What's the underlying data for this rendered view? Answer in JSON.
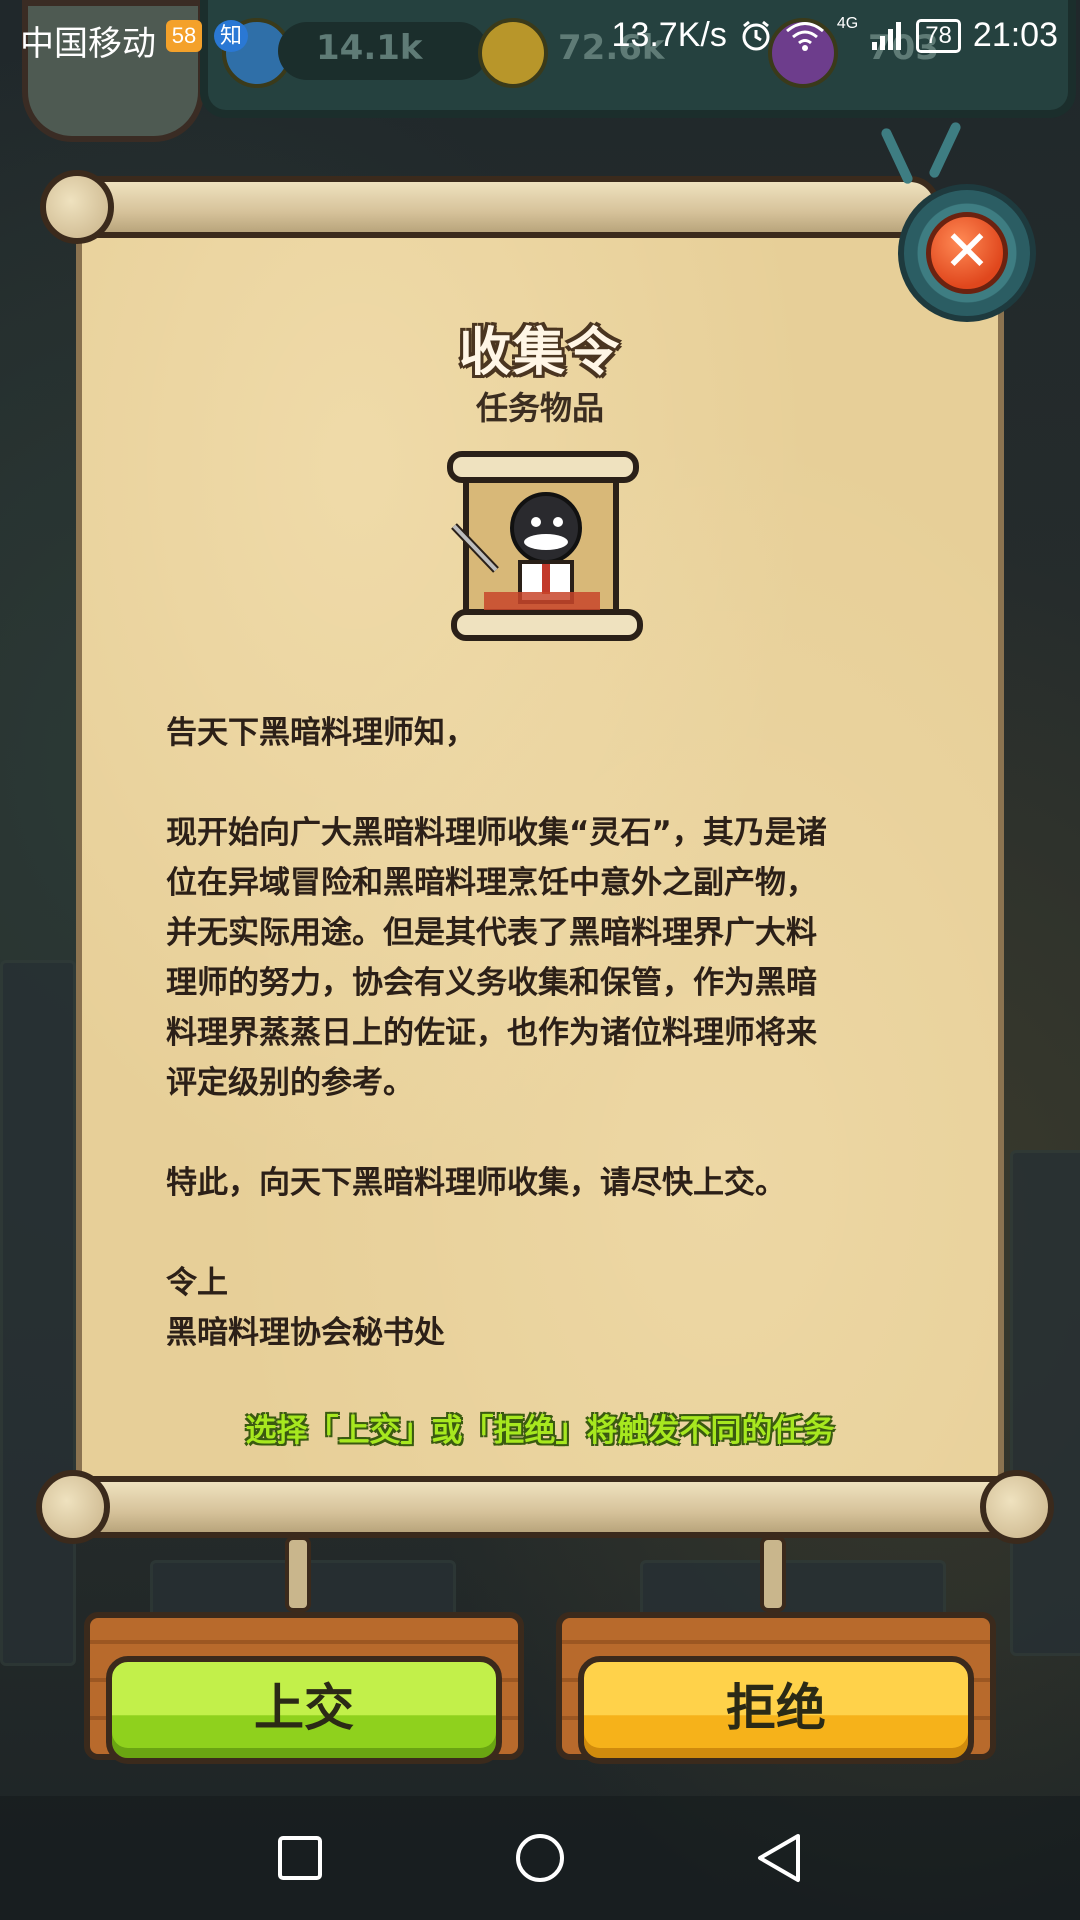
{
  "status_bar": {
    "carrier": "中国移动",
    "badge_58": "58",
    "badge_zhi": "知",
    "net_speed": "13.7K/s",
    "network": "4G",
    "battery": "78",
    "time": "21:03"
  },
  "hud": {
    "gems": "14.1k",
    "coins": "72.6k",
    "potions": "703"
  },
  "dialog": {
    "title": "收集令",
    "subtitle": "任务物品",
    "greeting": "告天下黑暗料理师知，",
    "paragraph_lines": [
      "现开始向广大黑暗料理师收集“灵石”，其乃是诸",
      "位在异域冒险和黑暗料理烹饪中意外之副产物，",
      "并无实际用途。但是其代表了黑暗料理界广大料",
      "理师的努力，协会有义务收集和保管，作为黑暗",
      "料理界蒸蒸日上的佐证，也作为诸位料理师将来",
      "评定级别的参考。"
    ],
    "closing": "特此，向天下黑暗料理师收集，请尽快上交。",
    "sign_line1": "令上",
    "sign_line2": "黑暗料理协会秘书处",
    "hint": "选择「上交」或「拒绝」将触发不同的任务",
    "close_icon": "close-icon"
  },
  "buttons": {
    "submit": "上交",
    "reject": "拒绝"
  },
  "nav": {
    "icons": [
      "recent-apps-icon",
      "home-icon",
      "back-icon"
    ]
  },
  "colors": {
    "parchment": "#e7cf98",
    "hint_green": "#a7e81f",
    "submit_green": "#8fd11d",
    "reject_yellow": "#f6b21a",
    "close_red": "#e0471d"
  }
}
